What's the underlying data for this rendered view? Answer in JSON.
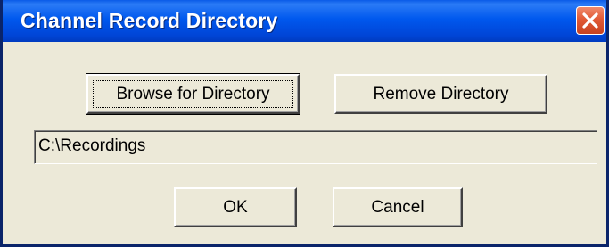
{
  "window": {
    "title": "Channel Record Directory",
    "close_icon": "close-x-icon"
  },
  "buttons": {
    "browse_label": "Browse for Directory",
    "remove_label": "Remove Directory",
    "ok_label": "OK",
    "cancel_label": "Cancel"
  },
  "directory": {
    "path": "C:\\Recordings"
  },
  "colors": {
    "titlebar": "#0058ee",
    "dialog_background": "#ece9d8",
    "close_button": "#e15a36"
  }
}
